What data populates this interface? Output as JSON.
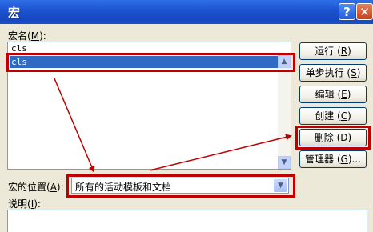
{
  "window": {
    "title": "宏",
    "help_glyph": "?",
    "close_glyph": "✕"
  },
  "macro_name": {
    "label": "宏名",
    "mnemonic_open": "(",
    "mnemonic": "M",
    "mnemonic_close": "):",
    "value": "cls",
    "list_items": [
      "cls"
    ],
    "selected_index": 0
  },
  "location": {
    "label": "宏的位置",
    "mnemonic_open": "(",
    "mnemonic": "A",
    "mnemonic_close": "):",
    "value": "所有的活动模板和文档"
  },
  "description": {
    "label": "说明",
    "mnemonic_open": "(",
    "mnemonic": "I",
    "mnemonic_close": "):"
  },
  "buttons": [
    {
      "text": "运行",
      "open": "(",
      "mnemonic": "R",
      "close": ")"
    },
    {
      "text": "单步执行",
      "open": "(",
      "mnemonic": "S",
      "close": ")"
    },
    {
      "text": "编辑",
      "open": "(",
      "mnemonic": "E",
      "close": ")"
    },
    {
      "text": "创建",
      "open": "(",
      "mnemonic": "C",
      "close": ")"
    },
    {
      "text": "删除",
      "open": "(",
      "mnemonic": "D",
      "close": ")"
    },
    {
      "text": "管理器",
      "open": "(",
      "mnemonic": "G",
      "close": ")..."
    }
  ],
  "icons": {
    "scroll_up": "▲",
    "scroll_down": "▼",
    "dropdown": "▼"
  },
  "colors": {
    "titlebar": "#1d54d1",
    "selection": "#316ac5",
    "annotation": "#c00000"
  }
}
